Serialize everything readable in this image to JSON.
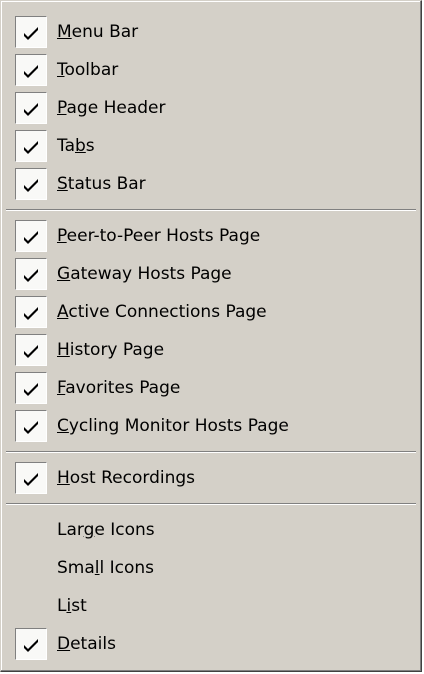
{
  "menu": {
    "groups": [
      {
        "items": [
          {
            "label_pre": "",
            "label_mn": "M",
            "label_post": "enu Bar",
            "checked": true
          },
          {
            "label_pre": "",
            "label_mn": "T",
            "label_post": "oolbar",
            "checked": true
          },
          {
            "label_pre": "",
            "label_mn": "P",
            "label_post": "age Header",
            "checked": true
          },
          {
            "label_pre": "Ta",
            "label_mn": "b",
            "label_post": "s",
            "checked": true
          },
          {
            "label_pre": "",
            "label_mn": "S",
            "label_post": "tatus Bar",
            "checked": true
          }
        ]
      },
      {
        "items": [
          {
            "label_pre": "",
            "label_mn": "P",
            "label_post": "eer-to-Peer Hosts Page",
            "checked": true
          },
          {
            "label_pre": "",
            "label_mn": "G",
            "label_post": "ateway Hosts Page",
            "checked": true
          },
          {
            "label_pre": "",
            "label_mn": "A",
            "label_post": "ctive Connections Page",
            "checked": true
          },
          {
            "label_pre": "",
            "label_mn": "H",
            "label_post": "istory Page",
            "checked": true
          },
          {
            "label_pre": "",
            "label_mn": "F",
            "label_post": "avorites Page",
            "checked": true
          },
          {
            "label_pre": "",
            "label_mn": "C",
            "label_post": "ycling Monitor Hosts Page",
            "checked": true
          }
        ]
      },
      {
        "items": [
          {
            "label_pre": "",
            "label_mn": "H",
            "label_post": "ost Recordings",
            "checked": true
          }
        ]
      },
      {
        "items": [
          {
            "label_pre": "Lar",
            "label_mn": "g",
            "label_post": "e Icons",
            "checked": false
          },
          {
            "label_pre": "Sma",
            "label_mn": "l",
            "label_post": "l Icons",
            "checked": false
          },
          {
            "label_pre": "L",
            "label_mn": "i",
            "label_post": "st",
            "checked": false
          },
          {
            "label_pre": "",
            "label_mn": "D",
            "label_post": "etails",
            "checked": true
          }
        ]
      }
    ]
  },
  "icons": {
    "check": "checkmark-icon"
  },
  "colors": {
    "menu_bg": "#d4d0c8",
    "separator_dark": "#808080",
    "separator_light": "#ffffff",
    "text": "#000000"
  }
}
